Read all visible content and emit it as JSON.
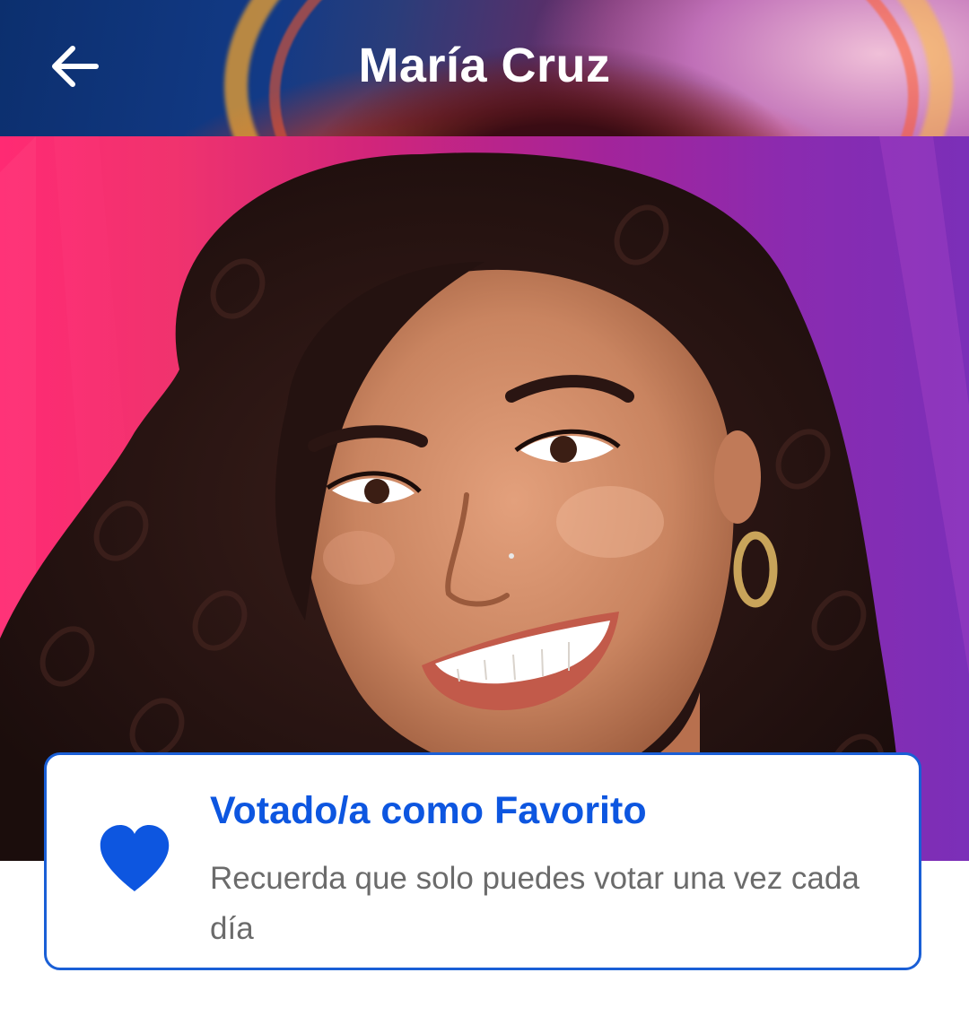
{
  "header": {
    "title": "María Cruz",
    "back_icon": "arrow-left-icon"
  },
  "photo": {
    "subject": "contestant-portrait"
  },
  "vote_card": {
    "icon": "heart-icon",
    "title": "Votado/a como Favorito",
    "subtitle": "Recuerda que solo puedes votar una vez cada día",
    "accent_color": "#0d56e0",
    "text_color": "#6b6b6b"
  },
  "colors": {
    "accent": "#1a5fd6",
    "background": "#ffffff"
  }
}
